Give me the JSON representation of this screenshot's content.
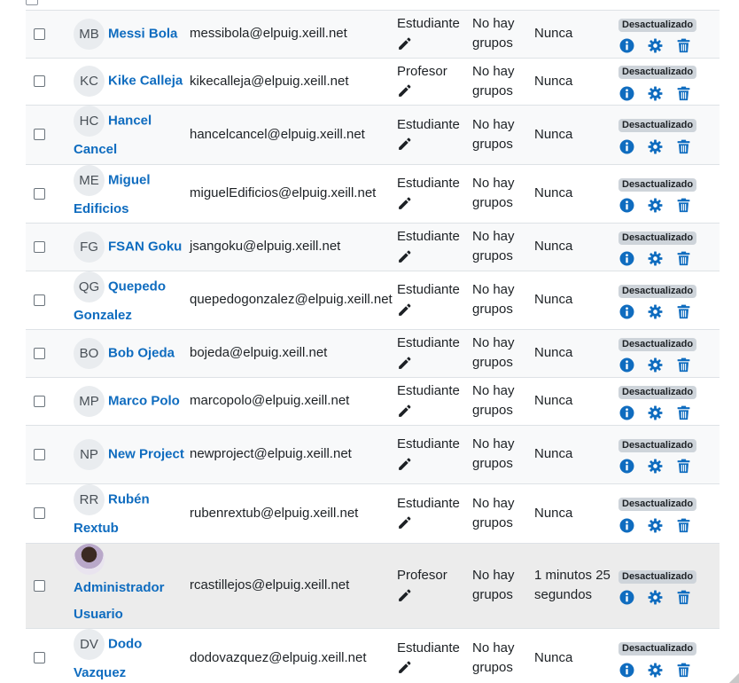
{
  "table": {
    "rows": [
      {
        "initials": "MB",
        "name": "Messi Bola",
        "email": "messibola@elpuig.xeill.net",
        "role": "Estudiante",
        "groups": "No hay grupos",
        "last_access": "Nunca",
        "status": "Desactualizado"
      },
      {
        "initials": "KC",
        "name": "Kike Calleja",
        "email": "kikecalleja@elpuig.xeill.net",
        "role": "Profesor",
        "groups": "No hay grupos",
        "last_access": "Nunca",
        "status": "Desactualizado"
      },
      {
        "initials": "HC",
        "name": "Hancel Cancel",
        "email": "hancelcancel@elpuig.xeill.net",
        "role": "Estudiante",
        "groups": "No hay grupos",
        "last_access": "Nunca",
        "status": "Desactualizado"
      },
      {
        "initials": "ME",
        "name": "Miguel Edificios",
        "email": "miguelEdificios@elpuig.xeill.net",
        "role": "Estudiante",
        "groups": "No hay grupos",
        "last_access": "Nunca",
        "status": "Desactualizado"
      },
      {
        "initials": "FG",
        "name": "FSAN Goku",
        "email": "jsangoku@elpuig.xeill.net",
        "role": "Estudiante",
        "groups": "No hay grupos",
        "last_access": "Nunca",
        "status": "Desactualizado"
      },
      {
        "initials": "QG",
        "name": "Quepedo Gonzalez",
        "email": "quepedogonzalez@elpuig.xeill.net",
        "role": "Estudiante",
        "groups": "No hay grupos",
        "last_access": "Nunca",
        "status": "Desactualizado"
      },
      {
        "initials": "BO",
        "name": "Bob Ojeda",
        "email": "bojeda@elpuig.xeill.net",
        "role": "Estudiante",
        "groups": "No hay grupos",
        "last_access": "Nunca",
        "status": "Desactualizado"
      },
      {
        "initials": "MP",
        "name": "Marco Polo",
        "email": "marcopolo@elpuig.xeill.net",
        "role": "Estudiante",
        "groups": "No hay grupos",
        "last_access": "Nunca",
        "status": "Desactualizado"
      },
      {
        "initials": "NP",
        "name": "New Project",
        "email": "newproject@elpuig.xeill.net",
        "role": "Estudiante",
        "groups": "No hay grupos",
        "last_access": "Nunca",
        "status": "Desactualizado"
      },
      {
        "initials": "RR",
        "name": "Rubén Rextub",
        "email": "rubenrextub@elpuig.xeill.net",
        "role": "Estudiante",
        "groups": "No hay grupos",
        "last_access": "Nunca",
        "status": "Desactualizado"
      },
      {
        "initials": "",
        "name": "Administrador Usuario",
        "email": "rcastillejos@elpuig.xeill.net",
        "role": "Profesor",
        "groups": "No hay grupos",
        "last_access": "1 minutos 25 segundos",
        "status": "Desactualizado"
      },
      {
        "initials": "DV",
        "name": "Dodo Vazquez",
        "email": "dodovazquez@elpuig.xeill.net",
        "role": "Estudiante",
        "groups": "No hay grupos",
        "last_access": "Nunca",
        "status": "Desactualizado"
      }
    ]
  },
  "colors": {
    "link": "#0f6cbf",
    "badge_bg": "#ced4da",
    "icon_blue": "#0f6cbf",
    "row_stripe": "#f8f9fa",
    "row_highlight": "#ececec"
  },
  "icons": {
    "edit_role": "pencil-icon",
    "info": "info-icon",
    "settings": "gear-icon",
    "delete": "trash-icon"
  }
}
